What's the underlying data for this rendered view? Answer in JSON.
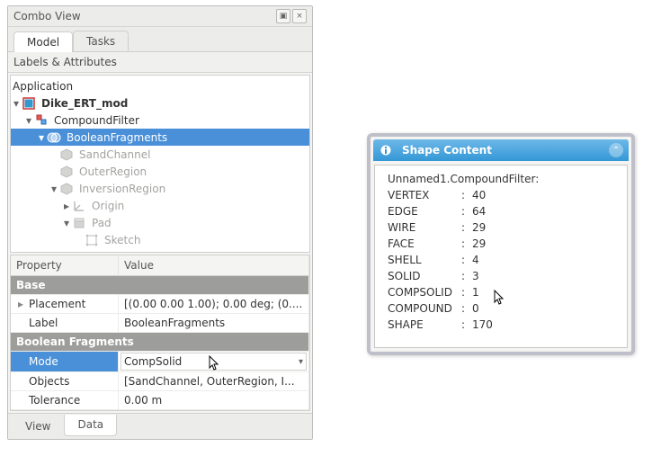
{
  "combo": {
    "title": "Combo View",
    "tabs": {
      "model": "Model",
      "tasks": "Tasks",
      "active": "model"
    },
    "section": "Labels & Attributes",
    "tree": {
      "root": "Application",
      "doc": "Dike_ERT_mod",
      "compound": "CompoundFilter",
      "bool": "BooleanFragments",
      "sand": "SandChannel",
      "outer": "OuterRegion",
      "inv": "InversionRegion",
      "origin": "Origin",
      "pad": "Pad",
      "sketch": "Sketch"
    },
    "prop_header": {
      "property": "Property",
      "value": "Value"
    },
    "groups": {
      "base": "Base",
      "boolfrag": "Boolean Fragments"
    },
    "props": {
      "placement": {
        "key": "Placement",
        "val": "[(0.00 0.00 1.00); 0.00 deg; (0...."
      },
      "label": {
        "key": "Label",
        "val": "BooleanFragments"
      },
      "mode": {
        "key": "Mode",
        "val": "CompSolid"
      },
      "objects": {
        "key": "Objects",
        "val": "[SandChannel, OuterRegion, I..."
      },
      "tolerance": {
        "key": "Tolerance",
        "val": "0.00 m"
      }
    },
    "bottom_tabs": {
      "view": "View",
      "data": "Data",
      "active": "data"
    }
  },
  "shape": {
    "title": "Shape Content",
    "header": "Unnamed1.CompoundFilter:",
    "rows": [
      {
        "k": "VERTEX",
        "v": "40"
      },
      {
        "k": "EDGE",
        "v": "64"
      },
      {
        "k": "WIRE",
        "v": "29"
      },
      {
        "k": "FACE",
        "v": "29"
      },
      {
        "k": "SHELL",
        "v": "4"
      },
      {
        "k": "SOLID",
        "v": "3"
      },
      {
        "k": "COMPSOLID",
        "v": "1"
      },
      {
        "k": "COMPOUND",
        "v": "0"
      },
      {
        "k": "SHAPE",
        "v": "170"
      }
    ]
  }
}
